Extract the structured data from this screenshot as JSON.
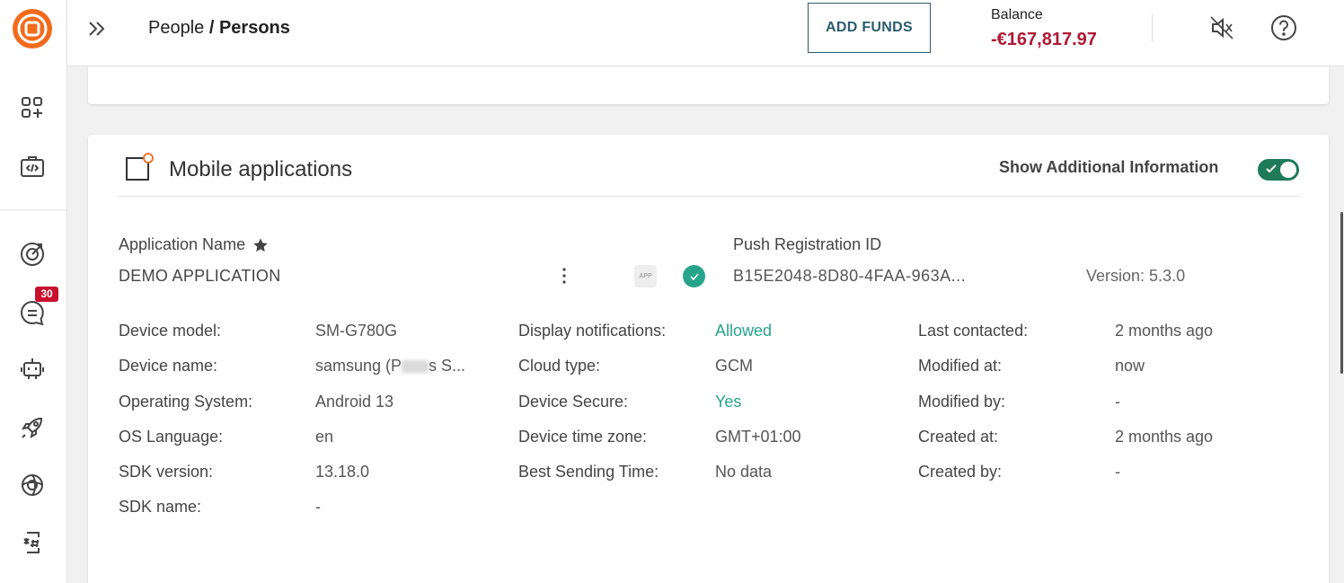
{
  "header": {
    "breadcrumb_parent": "People",
    "breadcrumb_separator": " / ",
    "breadcrumb_current": "Persons",
    "add_funds_label": "ADD FUNDS",
    "balance_label": "Balance",
    "balance_value": "-€167,817.97"
  },
  "sidebar": {
    "items": [
      {
        "name": "apps-icon"
      },
      {
        "name": "developer-tools-icon"
      },
      {
        "name": "target-icon"
      },
      {
        "name": "conversations-icon",
        "badge": "30"
      },
      {
        "name": "chatbot-icon"
      },
      {
        "name": "rocket-icon"
      },
      {
        "name": "ai-icon"
      },
      {
        "name": "exchange-icon"
      }
    ]
  },
  "card": {
    "title": "Mobile applications",
    "toggle_label": "Show Additional Information",
    "toggle_on": true,
    "app_name_label": "Application Name",
    "app_name": "DEMO APPLICATION",
    "app_chip": "APP",
    "push_id_label": "Push Registration ID",
    "push_id": "B15E2048-8D80-4FAA-963A...",
    "version": "Version: 5.3.0"
  },
  "details": {
    "col1": [
      {
        "label": "Device model:",
        "value": "SM-G780G"
      },
      {
        "label": "Device name:",
        "value_pre": "samsung (P",
        "value_post": "s S..."
      },
      {
        "label": "Operating System:",
        "value": "Android 13"
      },
      {
        "label": "OS Language:",
        "value": "en"
      },
      {
        "label": "SDK version:",
        "value": "13.18.0"
      },
      {
        "label": "SDK name:",
        "value": "-"
      }
    ],
    "col2": [
      {
        "label": "Display notifications:",
        "value": "Allowed"
      },
      {
        "label": "Cloud type:",
        "value": "GCM"
      },
      {
        "label": "Device Secure:",
        "value": "Yes"
      },
      {
        "label": "Device time zone:",
        "value": "GMT+01:00"
      },
      {
        "label": "Best Sending Time:",
        "value": "No data"
      }
    ],
    "col3": [
      {
        "label": "Last contacted:",
        "value": "2 months ago"
      },
      {
        "label": "Modified at:",
        "value": "now"
      },
      {
        "label": "Modified by:",
        "value": "-"
      },
      {
        "label": "Created at:",
        "value": "2 months ago"
      },
      {
        "label": "Created by:",
        "value": "-"
      }
    ]
  },
  "colors": {
    "accent_green": "#26a58a",
    "toggle_green": "#1f7a5a",
    "balance_red": "#b01834",
    "brand_orange": "#f26b1d",
    "add_funds_teal": "#2c5d6e"
  }
}
